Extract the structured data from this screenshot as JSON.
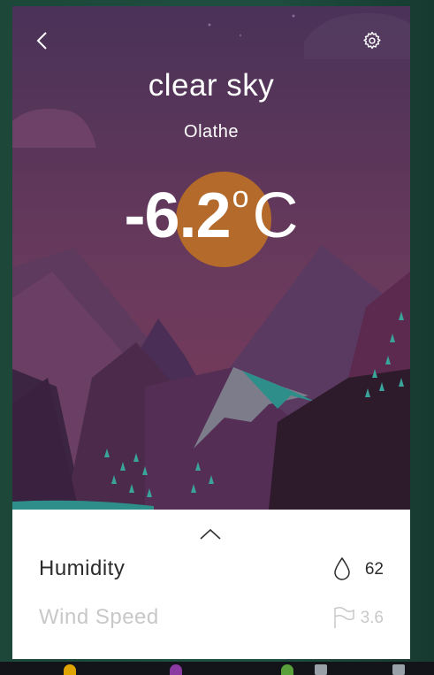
{
  "colors": {
    "sky_top": "#4a3258",
    "sky_bottom": "#7a3a5a",
    "sun": "#b36a2b",
    "panel": "#ffffff",
    "humidity_text": "#2b2b2b",
    "wind_text": "#c8c8c8",
    "desktop": "#1f4a3c"
  },
  "header": {
    "back_icon": "chevron-left-icon",
    "settings_icon": "gear-icon"
  },
  "weather": {
    "condition": "clear sky",
    "city": "Olathe",
    "temperature": "-6.2",
    "degree_symbol": "o",
    "unit": "C"
  },
  "details": {
    "expand_icon": "chevron-up-icon",
    "rows": [
      {
        "label": "Humidity",
        "icon": "droplet-icon",
        "value": "62"
      },
      {
        "label": "Wind Speed",
        "icon": "flag-icon",
        "value": "3.6"
      }
    ]
  }
}
